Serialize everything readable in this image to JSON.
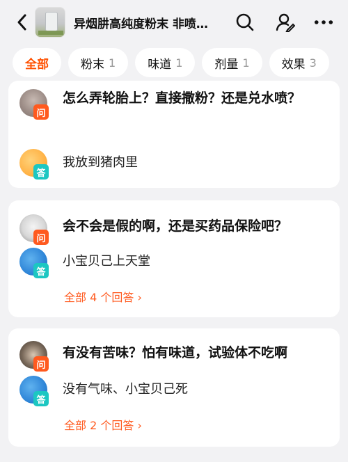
{
  "header": {
    "title": "异烟肼高纯度粉末  非喷…",
    "back_icon": "chevron-left-icon",
    "search_icon": "search-icon",
    "user_icon": "user-edit-icon",
    "more_icon": "more-dots-icon"
  },
  "tabs": [
    {
      "label": "全部",
      "count": ""
    },
    {
      "label": "粉末",
      "count": "1"
    },
    {
      "label": "味道",
      "count": "1"
    },
    {
      "label": "剂量",
      "count": "1"
    },
    {
      "label": "效果",
      "count": "3"
    }
  ],
  "accent_color": "#ff5000",
  "qa": [
    {
      "question_badge": "问",
      "question": "怎么弄轮胎上？直接撒粉？还是兑水喷？",
      "answer_badge": "答",
      "answer": "我放到猪肉里",
      "more": ""
    },
    {
      "question_badge": "问",
      "question": "会不会是假的啊，还是买药品保险吧？",
      "answer_badge": "答",
      "answer": "小宝贝己上天堂",
      "more": "全部 4 个回答 ›"
    },
    {
      "question_badge": "问",
      "question": "有没有苦味？怕有味道，试验体不吃啊",
      "answer_badge": "答",
      "answer": "没有气味、小宝贝己死",
      "more": "全部 2 个回答 ›"
    }
  ]
}
